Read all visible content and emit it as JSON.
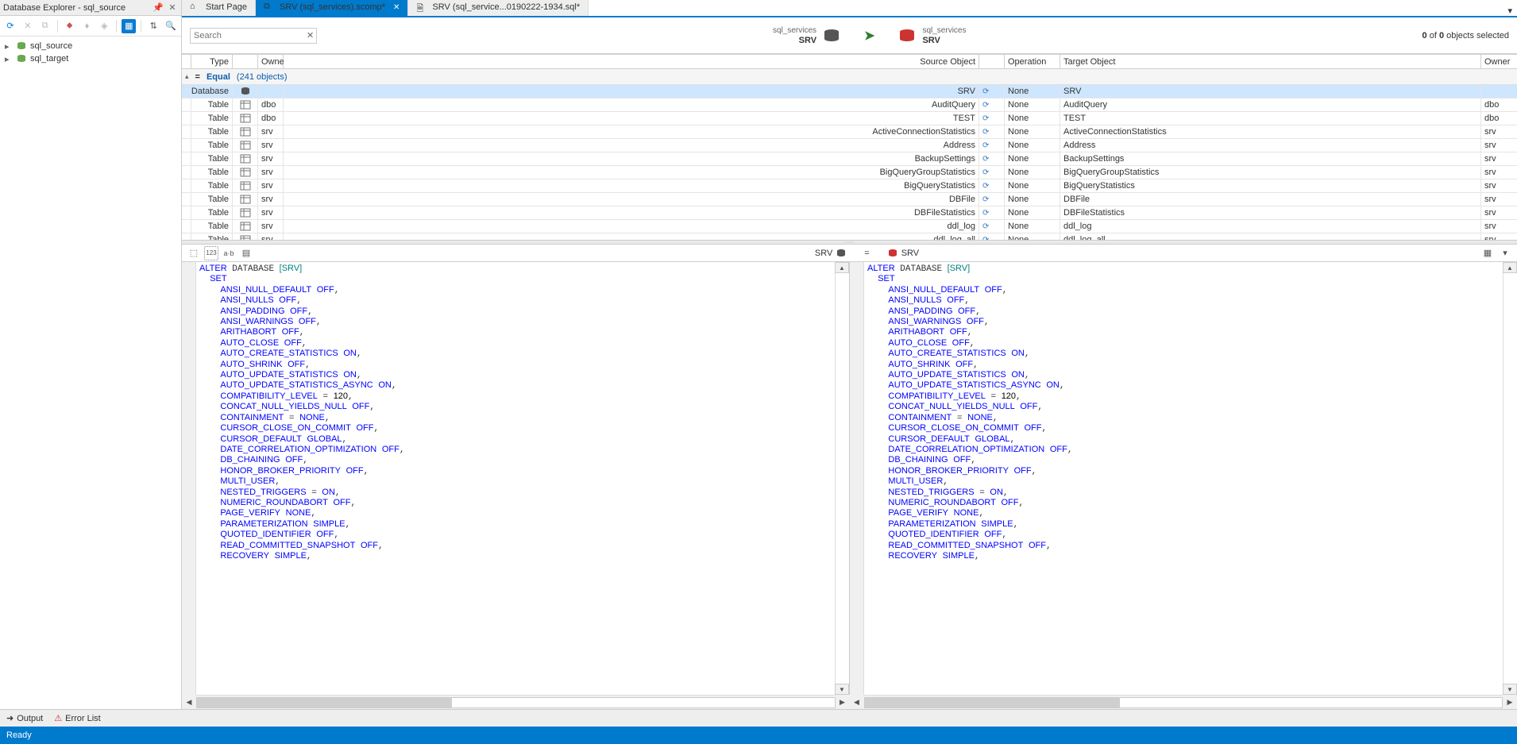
{
  "left_panel": {
    "title": "Database Explorer - sql_source",
    "tree": [
      "sql_source",
      "sql_target"
    ]
  },
  "tabs": {
    "items": [
      {
        "label": "Start Page",
        "kind": "start",
        "active": false,
        "closable": false
      },
      {
        "label": "SRV (sql_services).scomp*",
        "kind": "compare",
        "active": true,
        "closable": true
      },
      {
        "label": "SRV (sql_service...0190222-1934.sql*",
        "kind": "sql",
        "active": false,
        "closable": false
      }
    ]
  },
  "search": {
    "placeholder": "Search"
  },
  "compare_header": {
    "left": {
      "line1": "sql_services",
      "line2": "SRV"
    },
    "right": {
      "line1": "sql_services",
      "line2": "SRV"
    },
    "selection": {
      "prefix": "",
      "n1": "0",
      "mid": " of ",
      "n2": "0",
      "suffix": " objects selected"
    }
  },
  "grid": {
    "headers": {
      "type": "Type",
      "owner": "Owner",
      "source": "Source Object",
      "op": "Operation",
      "target": "Target Object",
      "owner2": "Owner"
    },
    "group": {
      "label": "Equal",
      "count": "(241 objects)"
    },
    "rows": [
      {
        "type": "Database",
        "owner": "",
        "source": "SRV",
        "op": "None",
        "target": "SRV",
        "owner2": "",
        "selected": true,
        "kind": "db"
      },
      {
        "type": "Table",
        "owner": "dbo",
        "source": "AuditQuery",
        "op": "None",
        "target": "AuditQuery",
        "owner2": "dbo",
        "kind": "table"
      },
      {
        "type": "Table",
        "owner": "dbo",
        "source": "TEST",
        "op": "None",
        "target": "TEST",
        "owner2": "dbo",
        "kind": "table"
      },
      {
        "type": "Table",
        "owner": "srv",
        "source": "ActiveConnectionStatistics",
        "op": "None",
        "target": "ActiveConnectionStatistics",
        "owner2": "srv",
        "kind": "table"
      },
      {
        "type": "Table",
        "owner": "srv",
        "source": "Address",
        "op": "None",
        "target": "Address",
        "owner2": "srv",
        "kind": "table"
      },
      {
        "type": "Table",
        "owner": "srv",
        "source": "BackupSettings",
        "op": "None",
        "target": "BackupSettings",
        "owner2": "srv",
        "kind": "table"
      },
      {
        "type": "Table",
        "owner": "srv",
        "source": "BigQueryGroupStatistics",
        "op": "None",
        "target": "BigQueryGroupStatistics",
        "owner2": "srv",
        "kind": "table"
      },
      {
        "type": "Table",
        "owner": "srv",
        "source": "BigQueryStatistics",
        "op": "None",
        "target": "BigQueryStatistics",
        "owner2": "srv",
        "kind": "table"
      },
      {
        "type": "Table",
        "owner": "srv",
        "source": "DBFile",
        "op": "None",
        "target": "DBFile",
        "owner2": "srv",
        "kind": "table"
      },
      {
        "type": "Table",
        "owner": "srv",
        "source": "DBFileStatistics",
        "op": "None",
        "target": "DBFileStatistics",
        "owner2": "srv",
        "kind": "table"
      },
      {
        "type": "Table",
        "owner": "srv",
        "source": "ddl_log",
        "op": "None",
        "target": "ddl_log",
        "owner2": "srv",
        "kind": "table"
      },
      {
        "type": "Table",
        "owner": "srv",
        "source": "ddl_log_all",
        "op": "None",
        "target": "ddl_log_all",
        "owner2": "srv",
        "kind": "table"
      }
    ]
  },
  "diff": {
    "left_label": "SRV",
    "right_label": "SRV",
    "equal_symbol": "=",
    "code": {
      "lines": [
        {
          "ind": 0,
          "seg": [
            {
              "t": "ALTER",
              "c": "kw"
            },
            {
              "t": " DATABASE ",
              "c": ""
            },
            {
              "t": "[SRV]",
              "c": "id"
            }
          ]
        },
        {
          "ind": 1,
          "seg": [
            {
              "t": "SET",
              "c": "kw"
            }
          ]
        },
        {
          "ind": 2,
          "seg": [
            {
              "t": "ANSI_NULL_DEFAULT",
              "c": "kw"
            },
            {
              "t": " ",
              "c": ""
            },
            {
              "t": "OFF",
              "c": "kw"
            },
            {
              "t": ",",
              "c": ""
            }
          ]
        },
        {
          "ind": 2,
          "seg": [
            {
              "t": "ANSI_NULLS",
              "c": "kw"
            },
            {
              "t": " ",
              "c": ""
            },
            {
              "t": "OFF",
              "c": "kw"
            },
            {
              "t": ",",
              "c": ""
            }
          ]
        },
        {
          "ind": 2,
          "seg": [
            {
              "t": "ANSI_PADDING",
              "c": "kw"
            },
            {
              "t": " ",
              "c": ""
            },
            {
              "t": "OFF",
              "c": "kw"
            },
            {
              "t": ",",
              "c": ""
            }
          ]
        },
        {
          "ind": 2,
          "seg": [
            {
              "t": "ANSI_WARNINGS",
              "c": "kw"
            },
            {
              "t": " ",
              "c": ""
            },
            {
              "t": "OFF",
              "c": "kw"
            },
            {
              "t": ",",
              "c": ""
            }
          ]
        },
        {
          "ind": 2,
          "seg": [
            {
              "t": "ARITHABORT",
              "c": "kw"
            },
            {
              "t": " ",
              "c": ""
            },
            {
              "t": "OFF",
              "c": "kw"
            },
            {
              "t": ",",
              "c": ""
            }
          ]
        },
        {
          "ind": 2,
          "seg": [
            {
              "t": "AUTO_CLOSE",
              "c": "kw"
            },
            {
              "t": " ",
              "c": ""
            },
            {
              "t": "OFF",
              "c": "kw"
            },
            {
              "t": ",",
              "c": ""
            }
          ]
        },
        {
          "ind": 2,
          "seg": [
            {
              "t": "AUTO_CREATE_STATISTICS",
              "c": "kw"
            },
            {
              "t": " ",
              "c": ""
            },
            {
              "t": "ON",
              "c": "kw"
            },
            {
              "t": ",",
              "c": ""
            }
          ]
        },
        {
          "ind": 2,
          "seg": [
            {
              "t": "AUTO_SHRINK",
              "c": "kw"
            },
            {
              "t": " ",
              "c": ""
            },
            {
              "t": "OFF",
              "c": "kw"
            },
            {
              "t": ",",
              "c": ""
            }
          ]
        },
        {
          "ind": 2,
          "seg": [
            {
              "t": "AUTO_UPDATE_STATISTICS",
              "c": "kw"
            },
            {
              "t": " ",
              "c": ""
            },
            {
              "t": "ON",
              "c": "kw"
            },
            {
              "t": ",",
              "c": ""
            }
          ]
        },
        {
          "ind": 2,
          "seg": [
            {
              "t": "AUTO_UPDATE_STATISTICS_ASYNC",
              "c": "kw"
            },
            {
              "t": " ",
              "c": ""
            },
            {
              "t": "ON",
              "c": "kw"
            },
            {
              "t": ",",
              "c": ""
            }
          ]
        },
        {
          "ind": 2,
          "seg": [
            {
              "t": "COMPATIBILITY_LEVEL",
              "c": "kw"
            },
            {
              "t": " = ",
              "c": ""
            },
            {
              "t": "120",
              "c": "num"
            },
            {
              "t": ",",
              "c": ""
            }
          ]
        },
        {
          "ind": 2,
          "seg": [
            {
              "t": "CONCAT_NULL_YIELDS_NULL",
              "c": "kw"
            },
            {
              "t": " ",
              "c": ""
            },
            {
              "t": "OFF",
              "c": "kw"
            },
            {
              "t": ",",
              "c": ""
            }
          ]
        },
        {
          "ind": 2,
          "seg": [
            {
              "t": "CONTAINMENT",
              "c": "kw"
            },
            {
              "t": " = ",
              "c": ""
            },
            {
              "t": "NONE",
              "c": "kw"
            },
            {
              "t": ",",
              "c": ""
            }
          ]
        },
        {
          "ind": 2,
          "seg": [
            {
              "t": "CURSOR_CLOSE_ON_COMMIT",
              "c": "kw"
            },
            {
              "t": " ",
              "c": ""
            },
            {
              "t": "OFF",
              "c": "kw"
            },
            {
              "t": ",",
              "c": ""
            }
          ]
        },
        {
          "ind": 2,
          "seg": [
            {
              "t": "CURSOR_DEFAULT",
              "c": "kw"
            },
            {
              "t": " ",
              "c": ""
            },
            {
              "t": "GLOBAL",
              "c": "kw"
            },
            {
              "t": ",",
              "c": ""
            }
          ]
        },
        {
          "ind": 2,
          "seg": [
            {
              "t": "DATE_CORRELATION_OPTIMIZATION",
              "c": "kw"
            },
            {
              "t": " ",
              "c": ""
            },
            {
              "t": "OFF",
              "c": "kw"
            },
            {
              "t": ",",
              "c": ""
            }
          ]
        },
        {
          "ind": 2,
          "seg": [
            {
              "t": "DB_CHAINING",
              "c": "kw"
            },
            {
              "t": " ",
              "c": ""
            },
            {
              "t": "OFF",
              "c": "kw"
            },
            {
              "t": ",",
              "c": ""
            }
          ]
        },
        {
          "ind": 2,
          "seg": [
            {
              "t": "HONOR_BROKER_PRIORITY",
              "c": "kw"
            },
            {
              "t": " ",
              "c": ""
            },
            {
              "t": "OFF",
              "c": "kw"
            },
            {
              "t": ",",
              "c": ""
            }
          ]
        },
        {
          "ind": 2,
          "seg": [
            {
              "t": "MULTI_USER",
              "c": "kw"
            },
            {
              "t": ",",
              "c": ""
            }
          ]
        },
        {
          "ind": 2,
          "seg": [
            {
              "t": "NESTED_TRIGGERS",
              "c": "kw"
            },
            {
              "t": " = ",
              "c": ""
            },
            {
              "t": "ON",
              "c": "kw"
            },
            {
              "t": ",",
              "c": ""
            }
          ]
        },
        {
          "ind": 2,
          "seg": [
            {
              "t": "NUMERIC_ROUNDABORT",
              "c": "kw"
            },
            {
              "t": " ",
              "c": ""
            },
            {
              "t": "OFF",
              "c": "kw"
            },
            {
              "t": ",",
              "c": ""
            }
          ]
        },
        {
          "ind": 2,
          "seg": [
            {
              "t": "PAGE_VERIFY",
              "c": "kw"
            },
            {
              "t": " ",
              "c": ""
            },
            {
              "t": "NONE",
              "c": "kw"
            },
            {
              "t": ",",
              "c": ""
            }
          ]
        },
        {
          "ind": 2,
          "seg": [
            {
              "t": "PARAMETERIZATION",
              "c": "kw"
            },
            {
              "t": " ",
              "c": ""
            },
            {
              "t": "SIMPLE",
              "c": "kw"
            },
            {
              "t": ",",
              "c": ""
            }
          ]
        },
        {
          "ind": 2,
          "seg": [
            {
              "t": "QUOTED_IDENTIFIER",
              "c": "kw"
            },
            {
              "t": " ",
              "c": ""
            },
            {
              "t": "OFF",
              "c": "kw"
            },
            {
              "t": ",",
              "c": ""
            }
          ]
        },
        {
          "ind": 2,
          "seg": [
            {
              "t": "READ_COMMITTED_SNAPSHOT",
              "c": "kw"
            },
            {
              "t": " ",
              "c": ""
            },
            {
              "t": "OFF",
              "c": "kw"
            },
            {
              "t": ",",
              "c": ""
            }
          ]
        },
        {
          "ind": 2,
          "seg": [
            {
              "t": "RECOVERY",
              "c": "kw"
            },
            {
              "t": " ",
              "c": ""
            },
            {
              "t": "SIMPLE",
              "c": "kw"
            },
            {
              "t": ",",
              "c": ""
            }
          ]
        }
      ]
    }
  },
  "bottom_tabs": {
    "output": "Output",
    "error": "Error List"
  },
  "status": {
    "text": "Ready"
  }
}
